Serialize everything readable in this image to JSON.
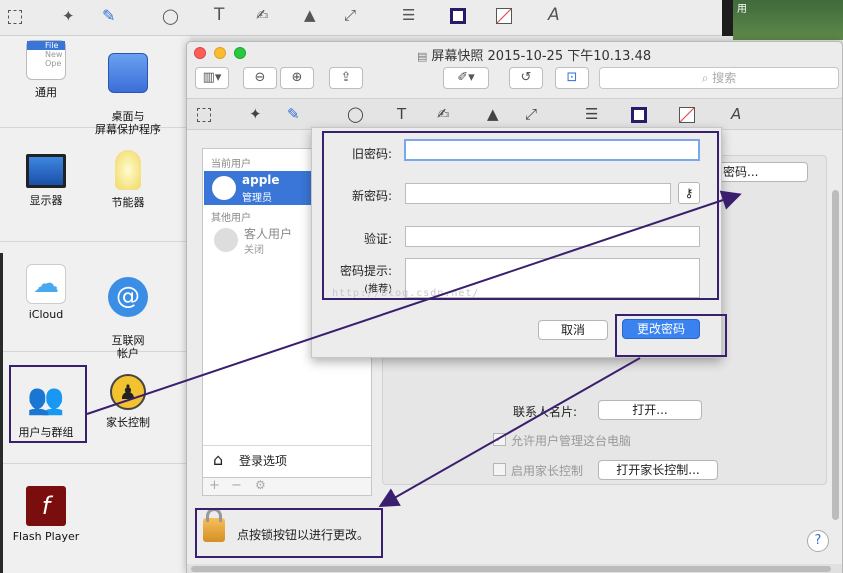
{
  "background_app": {
    "prefs": [
      {
        "id": "general",
        "label": "通用"
      },
      {
        "id": "desktop",
        "label": "桌面与\n屏幕保护程序"
      },
      {
        "id": "displays",
        "label": "显示器"
      },
      {
        "id": "energy",
        "label": "节能器"
      },
      {
        "id": "icloud",
        "label": "iCloud"
      },
      {
        "id": "internet",
        "label": "互联网\n帐户"
      },
      {
        "id": "users",
        "label": "用户与群组"
      },
      {
        "id": "parental",
        "label": "家长控制"
      },
      {
        "id": "flash",
        "label": "Flash Player"
      }
    ],
    "general_icon_text": [
      "File",
      "New",
      "Ope"
    ],
    "corner_label": "用"
  },
  "window": {
    "title": "屏幕快照 2015-10-25 下午10.13.48",
    "search_placeholder": "搜索"
  },
  "users_panel": {
    "current_header": "当前用户",
    "current_user": {
      "name": "apple",
      "role": "管理员"
    },
    "other_header": "其他用户",
    "guest_user": {
      "name": "客人用户",
      "status": "关闭"
    },
    "login_options": "登录选项",
    "change_password_button_partial": "密码...",
    "contacts_label": "联系人名片:",
    "open_button": "打开...",
    "allow_admin_label": "允许用户管理这台电脑",
    "parental_label": "启用家长控制",
    "open_parental_button": "打开家长控制...",
    "lock_text": "点按锁按钮以进行更改。",
    "help": "?"
  },
  "sheet": {
    "old_password_label": "旧密码:",
    "new_password_label": "新密码:",
    "verify_label": "验证:",
    "hint_label": "密码提示:",
    "hint_sub": "(推荐)",
    "cancel": "取消",
    "change": "更改密码",
    "watermark": "http://blog.csdn.net/"
  },
  "colors": {
    "accent": "#3a76d7",
    "annotation": "#3a1f6e"
  }
}
